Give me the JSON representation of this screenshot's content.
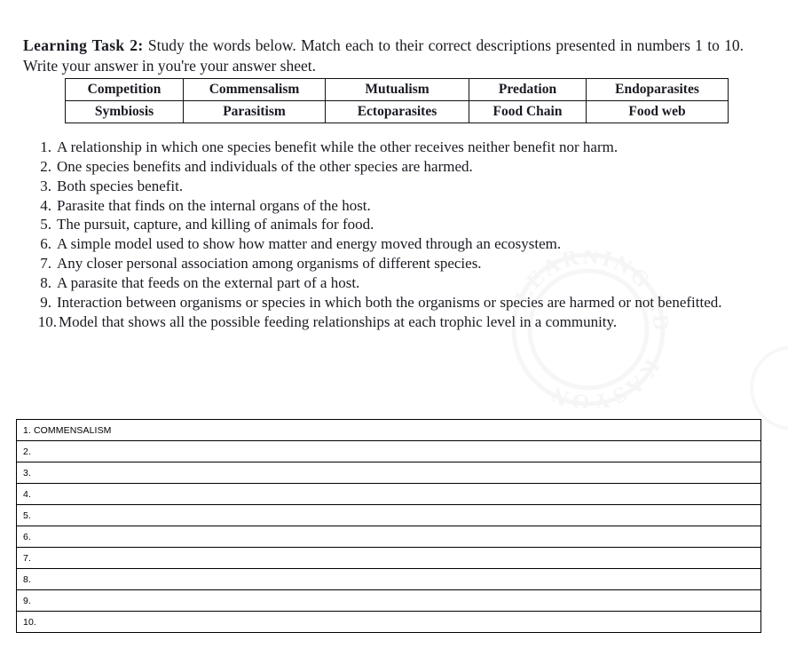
{
  "document": {
    "instruction_bold": "Learning Task 2:",
    "instruction_rest": " Study the words below. Match each to their correct descriptions presented in numbers 1 to 10. Write your answer in you're your answer sheet."
  },
  "word_bank": {
    "rows": [
      [
        "Competition",
        "Commensalism",
        "Mutualism",
        "Predation",
        "Endoparasites"
      ],
      [
        "Symbiosis",
        "Parasitism",
        "Ectoparasites",
        "Food Chain",
        "Food web"
      ]
    ]
  },
  "descriptions": [
    {
      "number": "1.",
      "text": "A relationship in which one species benefit while the other receives neither benefit nor harm."
    },
    {
      "number": "2.",
      "text": "One species benefits and individuals of the other species are harmed."
    },
    {
      "number": "3.",
      "text": "Both species benefit."
    },
    {
      "number": "4.",
      "text": "Parasite that finds on the internal organs of the host."
    },
    {
      "number": "5.",
      "text": "The pursuit, capture, and killing of animals for food."
    },
    {
      "number": "6.",
      "text": "A simple model used to show how matter and energy moved through an ecosystem."
    },
    {
      "number": "7.",
      "text": "Any closer personal association among organisms of different species."
    },
    {
      "number": "8.",
      "text": "A parasite that feeds on the external part of a host."
    },
    {
      "number": "9.",
      "text": "Interaction between organisms or species in which both the organisms or species are harmed or not benefitted."
    },
    {
      "number": "10.",
      "text": "Model that shows all the possible feeding relationships at each trophic level in a community."
    }
  ],
  "answer_sheet": {
    "rows": [
      "1. COMMENSALISM",
      "2.",
      "3.",
      "4.",
      "5.",
      "6.",
      "7.",
      "8.",
      "9.",
      "10."
    ]
  },
  "watermark": {
    "text_top": "LEARNING EDUKASYON",
    "color": "#eceaea"
  }
}
